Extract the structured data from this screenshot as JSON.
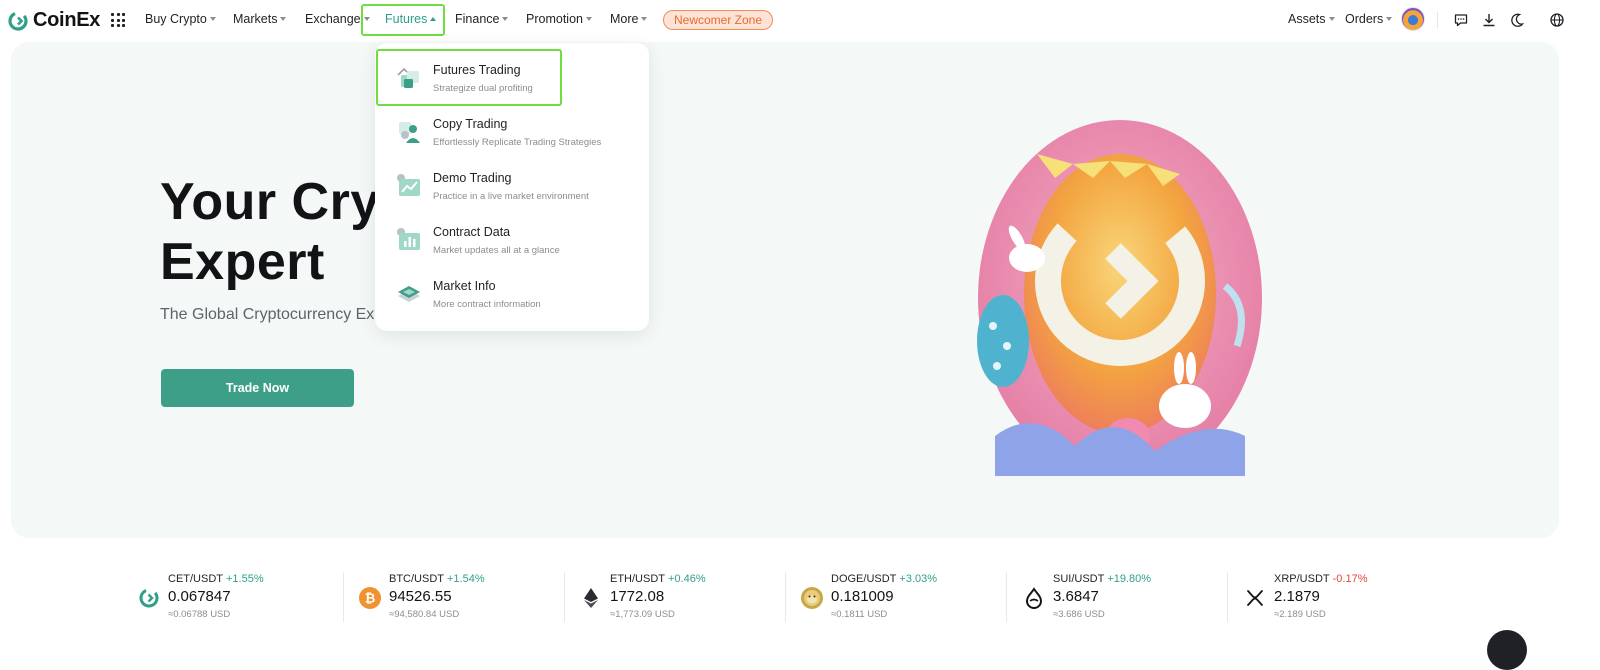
{
  "brand": {
    "name": "CoinEx",
    "color": "#2f9f8a"
  },
  "nav": {
    "items": [
      {
        "label": "Buy Crypto"
      },
      {
        "label": "Markets"
      },
      {
        "label": "Exchange"
      },
      {
        "label": "Futures",
        "active": true
      },
      {
        "label": "Finance"
      },
      {
        "label": "Promotion"
      },
      {
        "label": "More"
      }
    ],
    "newcomer": "Newcomer Zone",
    "assets": "Assets",
    "orders": "Orders"
  },
  "icons": {
    "apps": "apps-grid-icon",
    "message": "message-icon",
    "download": "download-icon",
    "theme": "moon-icon",
    "language": "globe-icon"
  },
  "hero": {
    "title_line1": "Your Cryp",
    "title_line2": "Expert",
    "subtitle": "The Global Cryptocurrency Exc",
    "cta": "Trade Now"
  },
  "futures_menu": [
    {
      "title": "Futures Trading",
      "desc": "Strategize dual profiting",
      "highlighted": true
    },
    {
      "title": "Copy Trading",
      "desc": "Effortlessly Replicate Trading Strategies"
    },
    {
      "title": "Demo Trading",
      "desc": "Practice in a live market environment"
    },
    {
      "title": "Contract Data",
      "desc": "Market updates all at a glance"
    },
    {
      "title": "Market Info",
      "desc": "More contract information"
    }
  ],
  "tickers": [
    {
      "pair": "CET/USDT",
      "change": "+1.55%",
      "direction": "up",
      "price": "0.067847",
      "usd": "≈0.06788 USD",
      "icon": "cet-icon"
    },
    {
      "pair": "BTC/USDT",
      "change": "+1.54%",
      "direction": "up",
      "price": "94526.55",
      "usd": "≈94,580.84 USD",
      "icon": "btc-icon"
    },
    {
      "pair": "ETH/USDT",
      "change": "+0.46%",
      "direction": "up",
      "price": "1772.08",
      "usd": "≈1,773.09 USD",
      "icon": "eth-icon"
    },
    {
      "pair": "DOGE/USDT",
      "change": "+3.03%",
      "direction": "up",
      "price": "0.181009",
      "usd": "≈0.1811 USD",
      "icon": "doge-icon"
    },
    {
      "pair": "SUI/USDT",
      "change": "+19.80%",
      "direction": "up",
      "price": "3.6847",
      "usd": "≈3.686 USD",
      "icon": "sui-icon"
    },
    {
      "pair": "XRP/USDT",
      "change": "-0.17%",
      "direction": "down",
      "price": "2.1879",
      "usd": "≈2.189 USD",
      "icon": "xrp-icon"
    }
  ]
}
